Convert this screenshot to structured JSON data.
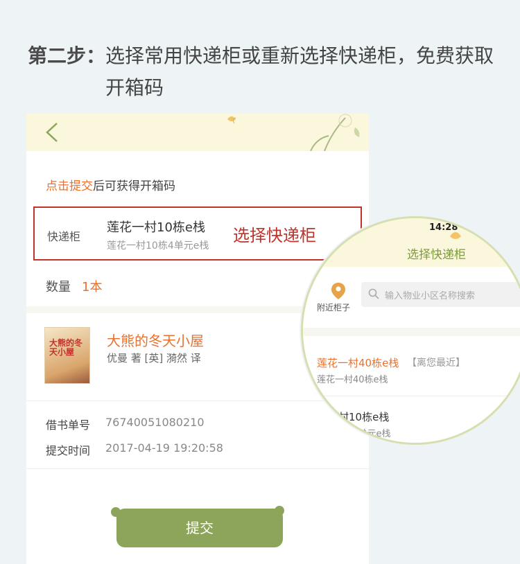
{
  "heading": {
    "label": "第二步：",
    "text": "选择常用快递柜或重新选择快递柜，免费获取开箱码"
  },
  "form": {
    "hint_accent": "点击提交",
    "hint_rest": "后可获得开箱码",
    "locker_label": "快递柜",
    "locker_name": "莲花一村10栋e栈",
    "locker_sub": "莲花一村10栋4单元e栈",
    "locker_annotation": "选择快递柜",
    "qty_label": "数量",
    "qty_value": "1本",
    "book_title": "大熊的冬天小屋",
    "book_author": "优曼 著 [英]      漪然 译",
    "cover_text": "大熊的冬天小屋",
    "order_label": "借书单号",
    "order_value": "76740051080210",
    "time_label": "提交时间",
    "time_value": "2017-04-19 19:20:58",
    "submit_label": "提交"
  },
  "magnifier": {
    "time": "14:28",
    "title": "选择快递柜",
    "nearby_label": "附近柜子",
    "search_placeholder": "输入物业小区名称搜索",
    "item1_name": "莲花一村40栋e栈",
    "item1_tag": "【离您最近】",
    "item1_sub": "莲花一村40栋e栈",
    "item2_name": "一村10栋e栈",
    "item2_sub": "0栋4单元e栈"
  },
  "colors": {
    "accent_orange": "#e8712e",
    "highlight_red": "#c0332a",
    "button_green": "#8ca55a",
    "header_cream": "#fbf7dc"
  }
}
